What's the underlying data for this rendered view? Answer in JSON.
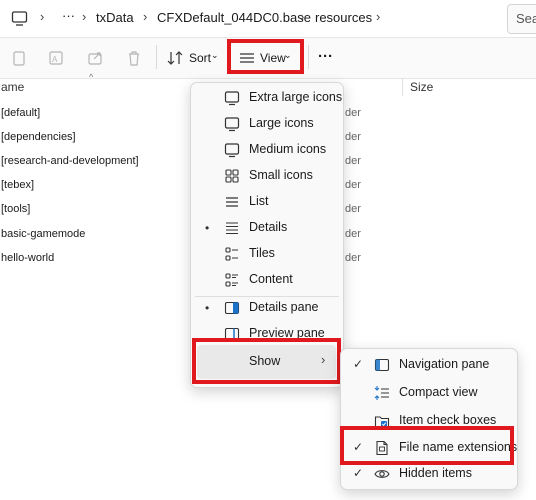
{
  "address_bar": {
    "breadcrumbs": [
      "txData",
      "CFXDefault_044DC0.base",
      "resources"
    ],
    "more": "···",
    "search_placeholder": "Sea"
  },
  "toolbar": {
    "sort_label": "Sort",
    "view_label": "View",
    "more_label": "···"
  },
  "columns": {
    "name": "ame",
    "size": "Size"
  },
  "files": [
    {
      "name": "[default]",
      "type_fragment": "der"
    },
    {
      "name": "[dependencies]",
      "type_fragment": "der"
    },
    {
      "name": "[research-and-development]",
      "type_fragment": "der"
    },
    {
      "name": "[tebex]",
      "type_fragment": "der"
    },
    {
      "name": "[tools]",
      "type_fragment": "der"
    },
    {
      "name": "basic-gamemode",
      "type_fragment": "der"
    },
    {
      "name": "hello-world",
      "type_fragment": "der"
    }
  ],
  "view_menu": {
    "items": [
      {
        "label": "Extra large icons",
        "icon": "monitor-icon",
        "selected": false
      },
      {
        "label": "Large icons",
        "icon": "monitor-icon",
        "selected": false
      },
      {
        "label": "Medium icons",
        "icon": "monitor-icon",
        "selected": false
      },
      {
        "label": "Small icons",
        "icon": "grid-icon",
        "selected": false
      },
      {
        "label": "List",
        "icon": "list-icon",
        "selected": false
      },
      {
        "label": "Details",
        "icon": "details-icon",
        "selected": true
      },
      {
        "label": "Tiles",
        "icon": "tiles-icon",
        "selected": false
      },
      {
        "label": "Content",
        "icon": "content-icon",
        "selected": false
      }
    ],
    "panes": [
      {
        "label": "Details pane",
        "icon": "details-pane-icon",
        "selected": true
      },
      {
        "label": "Preview pane",
        "icon": "preview-pane-icon",
        "selected": false
      }
    ],
    "show_label": "Show",
    "bullet": "•"
  },
  "show_submenu": {
    "check": "✓",
    "items": [
      {
        "label": "Navigation pane",
        "icon": "navigation-pane-icon",
        "checked": true
      },
      {
        "label": "Compact view",
        "icon": "compact-view-icon",
        "checked": false
      },
      {
        "label": "Item check boxes",
        "icon": "checkbox-icon",
        "checked": false
      },
      {
        "label": "File name extensions",
        "icon": "file-icon",
        "checked": true
      },
      {
        "label": "Hidden items",
        "icon": "eye-icon",
        "checked": true
      }
    ]
  },
  "colors": {
    "highlight_red": "#e0191e",
    "accent_blue": "#1a73c9"
  }
}
